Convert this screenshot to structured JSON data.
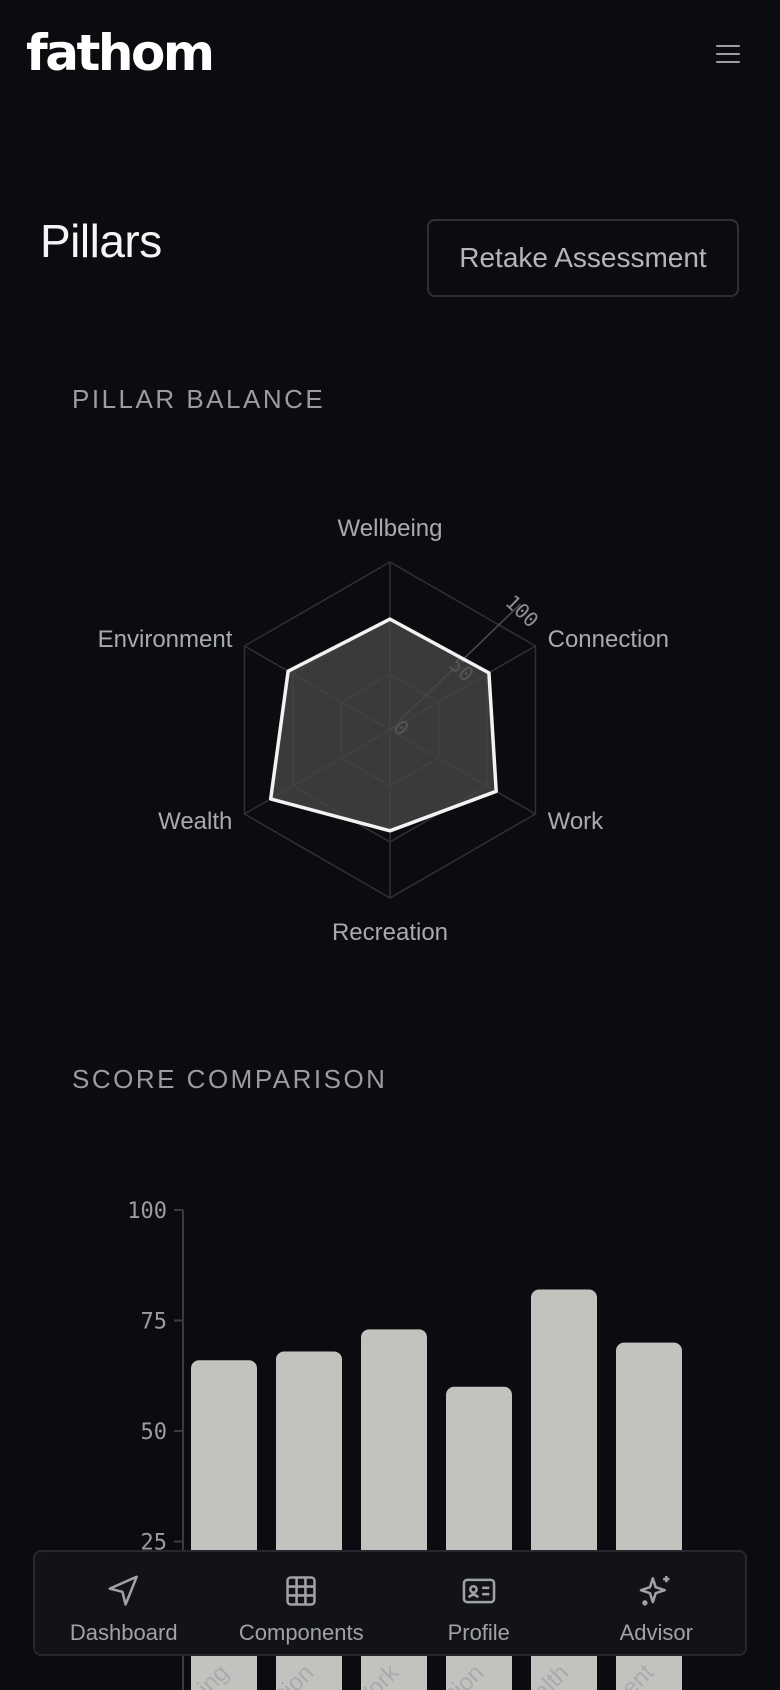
{
  "app": {
    "logo": "fathom"
  },
  "header": {
    "menu_icon": "hamburger-menu-icon"
  },
  "page": {
    "title": "Pillars",
    "retake_label": "Retake Assessment"
  },
  "sections": {
    "balance_title": "PILLAR BALANCE",
    "score_title": "SCORE COMPARISON"
  },
  "chart_data": [
    {
      "type": "radar",
      "axes": [
        "Wellbeing",
        "Connection",
        "Work",
        "Recreation",
        "Wealth",
        "Environment"
      ],
      "values": [
        66,
        68,
        73,
        60,
        82,
        70
      ],
      "range": [
        0,
        100
      ],
      "ticks": [
        "0",
        "50",
        "100"
      ],
      "rings": 3,
      "title": "",
      "colors": {
        "fill": "#464646",
        "stroke": "#f2f2f2",
        "grid": "#2f3137"
      }
    },
    {
      "type": "bar",
      "categories": [
        "Wellbeing",
        "Connection",
        "Work",
        "Recreation",
        "Wealth",
        "Environment"
      ],
      "values": [
        66,
        68,
        73,
        60,
        82,
        70
      ],
      "ylim": [
        0,
        100
      ],
      "yticks": [
        "25",
        "50",
        "75",
        "100"
      ],
      "xlabel": "",
      "ylabel": "",
      "title": "",
      "colors": {
        "bar": "#c2c2bf",
        "axis": "#3a3c42"
      }
    }
  ],
  "nav": {
    "items": [
      {
        "label": "Dashboard",
        "icon": "navigation-arrow-icon"
      },
      {
        "label": "Components",
        "icon": "grid-icon"
      },
      {
        "label": "Profile",
        "icon": "id-card-icon"
      },
      {
        "label": "Advisor",
        "icon": "sparkles-icon"
      }
    ]
  }
}
